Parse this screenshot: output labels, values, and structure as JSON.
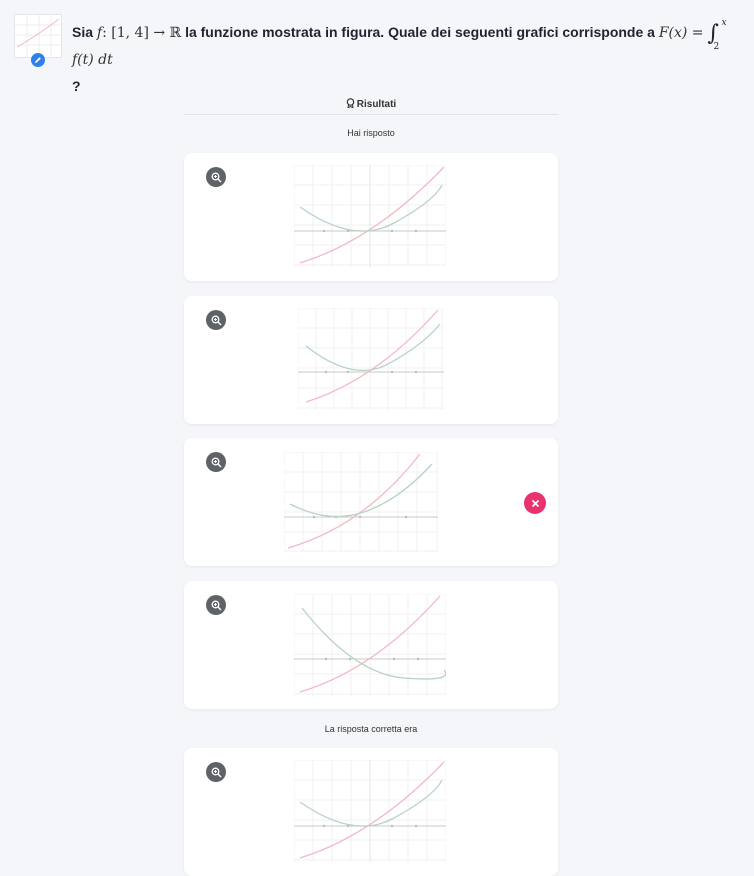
{
  "question": {
    "prefix": "Sia",
    "f_sym": "f",
    "domain": ": [1, 4] → ℝ",
    "text": "la funzione mostrata in figura. Quale dei seguenti grafici corrisponde a",
    "F_expr": "F(x) =",
    "int_upper": "x",
    "int_lower": "2",
    "integrand": "f(t) dt",
    "tail": "?"
  },
  "results": {
    "title": "Risultati",
    "title_icon": "award-icon",
    "answered_label": "Hai risposto",
    "correct_label": "La risposta corretta era"
  },
  "icons": {
    "zoom": "zoom-in-icon",
    "wrong": "x-circle-icon",
    "edit": "pencil-icon"
  },
  "colors": {
    "red_curve": "#f2b9c3",
    "green_curve": "#b7d3c4",
    "wrong_badge": "#e8336d",
    "edit_badge": "#2f80ed",
    "zoom_button": "#5f6368"
  },
  "options": [
    {
      "id": "A",
      "selected": false,
      "marked_wrong": false
    },
    {
      "id": "B",
      "selected": false,
      "marked_wrong": false
    },
    {
      "id": "C",
      "selected": true,
      "marked_wrong": true
    },
    {
      "id": "D",
      "selected": false,
      "marked_wrong": false
    }
  ],
  "correct_option": {
    "id": "A"
  }
}
